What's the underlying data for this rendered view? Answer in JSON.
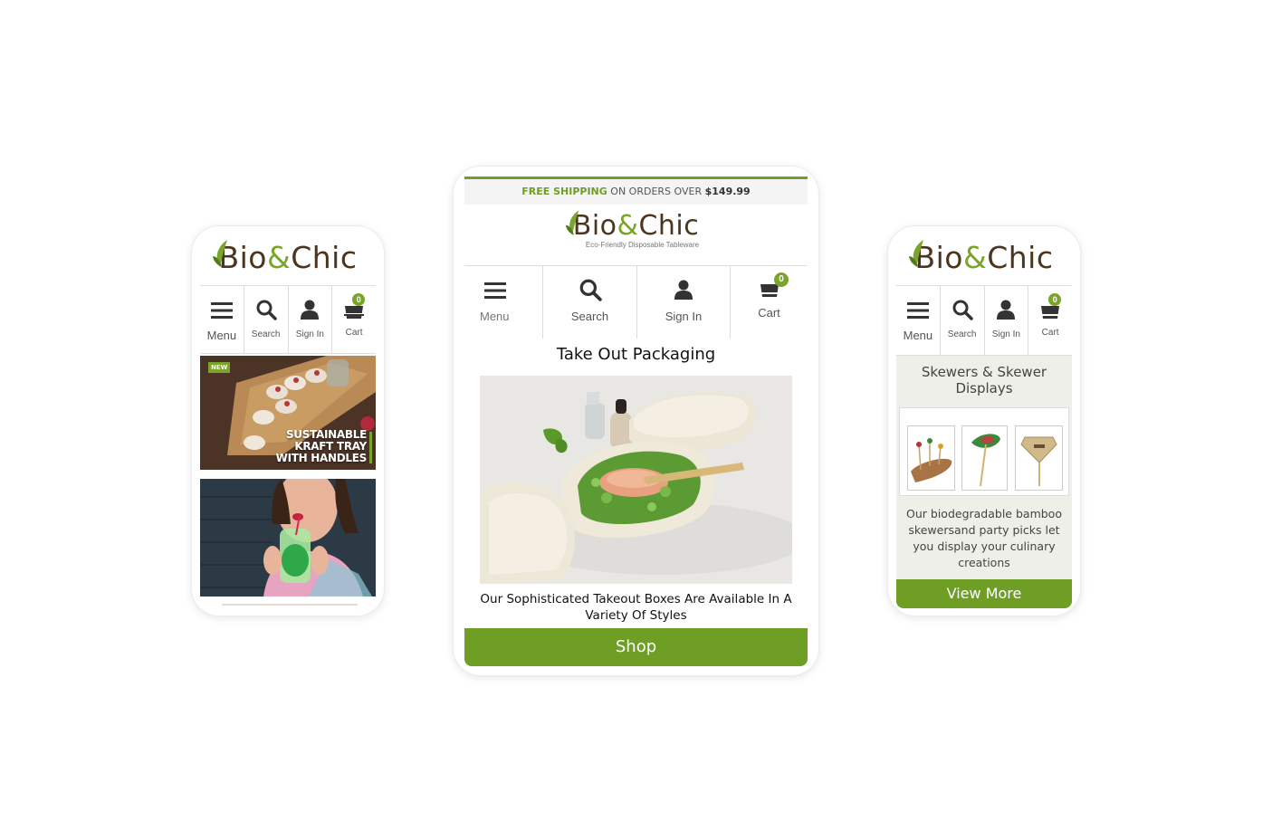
{
  "brand": {
    "name_part1": "Bio",
    "name_amp": "&",
    "name_part2": "Chic",
    "tagline": "Eco-Friendly Disposable Tableware"
  },
  "colors": {
    "accent": "#6f9e25",
    "brown": "#4a3521",
    "badge": "#7aa52a"
  },
  "nav": {
    "menu": "Menu",
    "search": "Search",
    "signin": "Sign In",
    "cart": "Cart",
    "cart_count": "0"
  },
  "phone_left": {
    "banner1": {
      "badge": "NEW",
      "line1": "SUSTAINABLE",
      "line2": "KRAFT TRAY",
      "line3": "WITH HANDLES"
    }
  },
  "phone_center": {
    "shipping": {
      "highlight": "FREE SHIPPING",
      "middle": "ON ORDERS OVER",
      "amount": "$149.99"
    },
    "title": "Take Out Packaging",
    "description": "Our Sophisticated Takeout Boxes Are Available In A Variety Of Styles",
    "button": "Shop"
  },
  "phone_right": {
    "title": "Skewers & Skewer Displays",
    "description": "Our biodegradable bamboo skewersand party picks let you display your culinary creations",
    "button": "View More"
  }
}
